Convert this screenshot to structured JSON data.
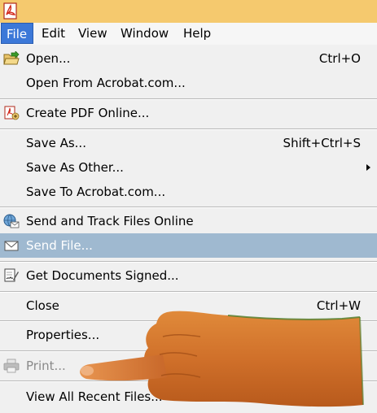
{
  "menubar": {
    "items": [
      {
        "label": "File",
        "active": true
      },
      {
        "label": "Edit"
      },
      {
        "label": "View"
      },
      {
        "label": "Window"
      },
      {
        "label": "Help"
      }
    ]
  },
  "file_menu": {
    "items": [
      {
        "label": "Open...",
        "shortcut": "Ctrl+O",
        "icon": "open-folder-icon"
      },
      {
        "label": "Open From Acrobat.com..."
      },
      {
        "label": "Create PDF Online...",
        "icon": "create-pdf-icon"
      },
      {
        "label": "Save As...",
        "shortcut": "Shift+Ctrl+S"
      },
      {
        "label": "Save As Other...",
        "submenu": true
      },
      {
        "label": "Save To Acrobat.com..."
      },
      {
        "label": "Send and Track Files Online",
        "icon": "globe-mail-icon"
      },
      {
        "label": "Send File...",
        "icon": "envelope-icon",
        "highlighted": true
      },
      {
        "label": "Get Documents Signed...",
        "icon": "sign-document-icon"
      },
      {
        "label": "Close",
        "shortcut": "Ctrl+W"
      },
      {
        "label": "Properties..."
      },
      {
        "label": "Print...",
        "icon": "printer-icon",
        "disabled": true
      },
      {
        "label": "View All Recent Files..."
      }
    ]
  },
  "colors": {
    "titlebar": "#f5c96e",
    "menu_active": "#3c78d8",
    "item_highlight": "#9fb9d0",
    "menu_background": "#f0f0f0"
  }
}
